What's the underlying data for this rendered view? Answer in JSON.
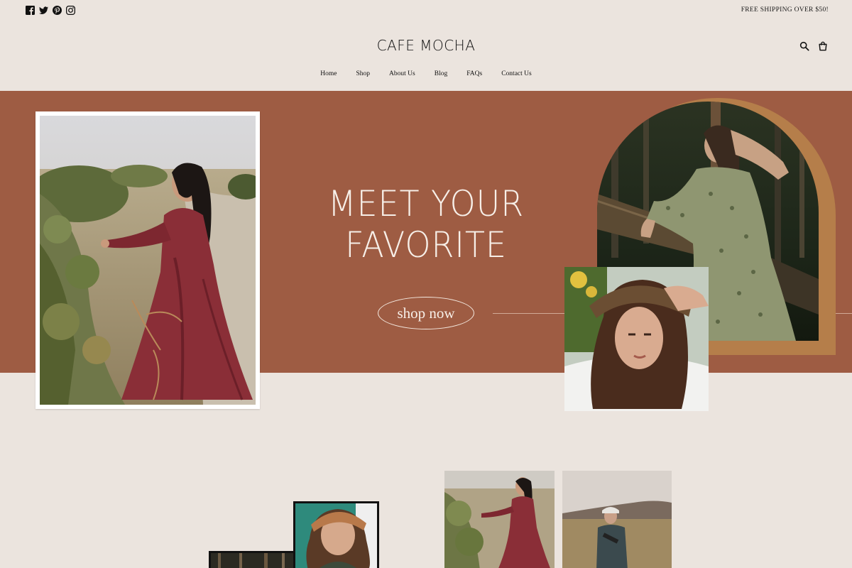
{
  "topbar": {
    "socials": [
      {
        "icon": "facebook-icon"
      },
      {
        "icon": "twitter-icon"
      },
      {
        "icon": "pinterest-icon"
      },
      {
        "icon": "instagram-icon"
      }
    ],
    "shipping_text": "FREE SHIPPING OVER $50!"
  },
  "header": {
    "logo": "CAFE MOCHA",
    "icons": [
      "search-icon",
      "cart-icon"
    ]
  },
  "nav": {
    "items": [
      {
        "label": "Home"
      },
      {
        "label": "Shop"
      },
      {
        "label": "About Us"
      },
      {
        "label": "Blog"
      },
      {
        "label": "FAQs"
      },
      {
        "label": "Contact Us"
      }
    ]
  },
  "hero": {
    "headline_line1": "MEET YOUR",
    "headline_line2": "FAVORITE",
    "cta_label": "shop now"
  },
  "colors": {
    "background": "#ebe4de",
    "hero_band": "#9e5c43",
    "arch_accent": "#b57e4a",
    "hero_text": "#f7efe8"
  }
}
